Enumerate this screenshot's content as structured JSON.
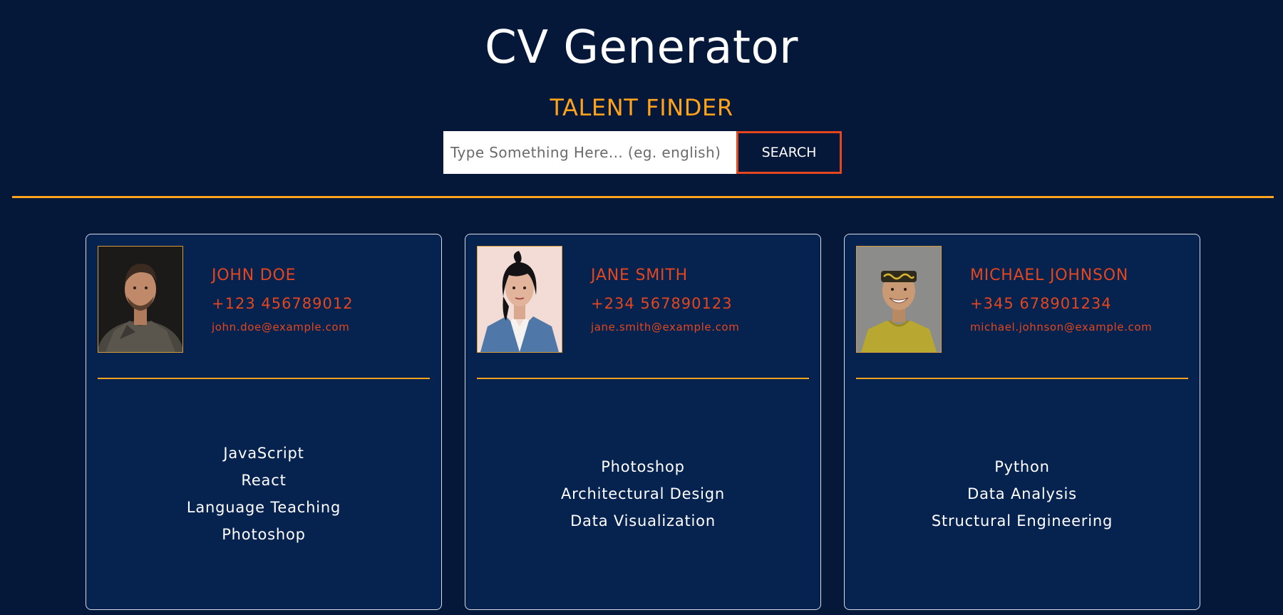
{
  "header": {
    "title": "CV Generator",
    "subtitle": "TALENT FINDER"
  },
  "search": {
    "placeholder": "Type Something Here... (eg. english)",
    "value": "",
    "button_label": "SEARCH"
  },
  "colors": {
    "background": "#06183a",
    "card_background": "#06224f",
    "accent_orange": "#ffa31a",
    "accent_red": "#e4461d"
  },
  "cards": [
    {
      "name": "JOHN DOE",
      "phone": "+123 456789012",
      "email": "john.doe@example.com",
      "photo_icon": "portrait-man-beard",
      "skills": [
        "JavaScript",
        "React",
        "Language Teaching",
        "Photoshop"
      ]
    },
    {
      "name": "JANE SMITH",
      "phone": "+234 567890123",
      "email": "jane.smith@example.com",
      "photo_icon": "portrait-woman-denim",
      "skills": [
        "Photoshop",
        "Architectural Design",
        "Data Visualization"
      ]
    },
    {
      "name": "MICHAEL JOHNSON",
      "phone": "+345 678901234",
      "email": "michael.johnson@example.com",
      "photo_icon": "portrait-man-headband",
      "skills": [
        "Python",
        "Data Analysis",
        "Structural Engineering"
      ]
    }
  ]
}
